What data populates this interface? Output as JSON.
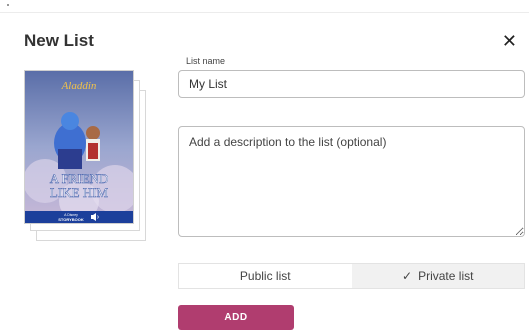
{
  "dialog": {
    "title": "New List",
    "close_icon": "close-icon",
    "close_glyph": "✕"
  },
  "book": {
    "series_logo": "Aladdin",
    "cover_title_line1": "A FRIEND",
    "cover_title_line2": "LIKE HIM",
    "badge_line1": "A Disney",
    "badge_line2": "STORYBOOK"
  },
  "form": {
    "name_label": "List name",
    "name_value": "My List",
    "description_placeholder": "Add a description to the list (optional)"
  },
  "visibility": {
    "public_label": "Public list",
    "private_label": "Private list",
    "check_glyph": "✓",
    "selected": "private"
  },
  "actions": {
    "add_label": "ADD"
  },
  "colors": {
    "accent": "#b03d6f"
  }
}
